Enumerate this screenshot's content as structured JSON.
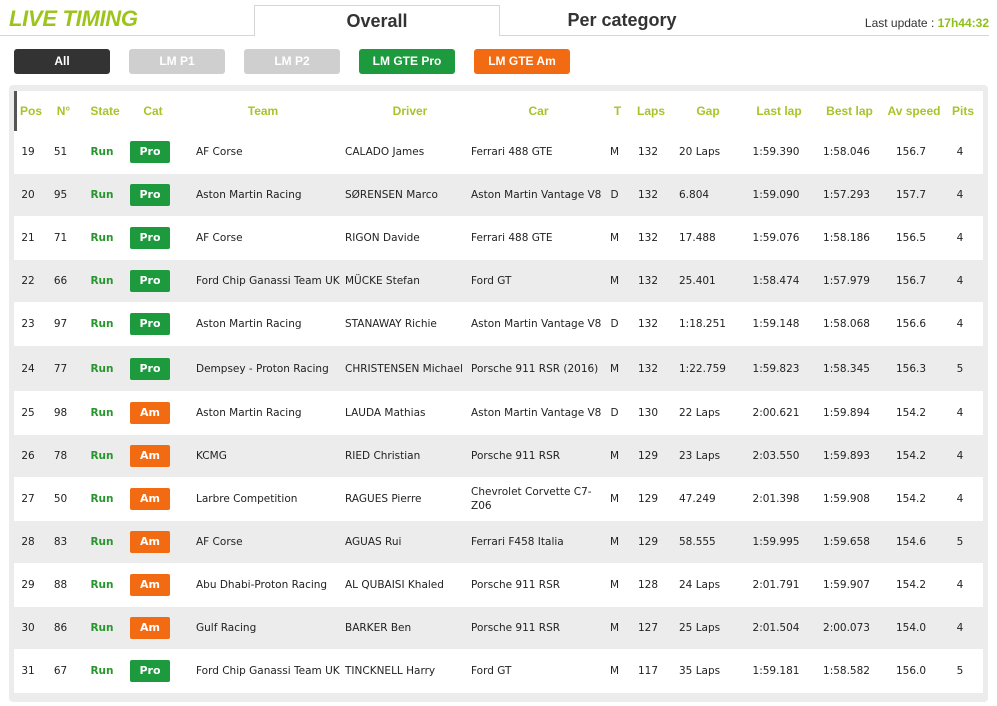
{
  "header": {
    "logo": "LIVE TIMING",
    "tabs": [
      {
        "label": "Overall"
      },
      {
        "label": "Per category"
      }
    ],
    "last_update_label": "Last update :",
    "last_update_time": "17h44:32"
  },
  "filters": [
    {
      "label": "All",
      "color": "#333333"
    },
    {
      "label": "LM P1",
      "color": "#cfcfcf"
    },
    {
      "label": "LM P2",
      "color": "#cfcfcf"
    },
    {
      "label": "LM GTE Pro",
      "color": "#1d9a3d"
    },
    {
      "label": "LM GTE Am",
      "color": "#f26b12"
    }
  ],
  "columns": {
    "pos": "Pos",
    "num": "N°",
    "state": "State",
    "cat": "Cat",
    "team": "Team",
    "driver": "Driver",
    "car": "Car",
    "t": "T",
    "laps": "Laps",
    "gap": "Gap",
    "last_lap": "Last lap",
    "best_lap": "Best lap",
    "av_speed": "Av speed",
    "pits": "Pits"
  },
  "colors": {
    "header_text": "#a6c528",
    "run": "#27962d",
    "pro": "#1d9a3d",
    "am": "#f26b12"
  },
  "rows": [
    {
      "pos": "19",
      "num": "51",
      "state": "Run",
      "cat": "Pro",
      "team": "AF Corse",
      "driver": "CALADO James",
      "car": "Ferrari 488 GTE",
      "t": "M",
      "laps": "132",
      "gap": "20 Laps",
      "last_lap": "1:59.390",
      "best_lap": "1:58.046",
      "av_speed": "156.7",
      "pits": "4"
    },
    {
      "pos": "20",
      "num": "95",
      "state": "Run",
      "cat": "Pro",
      "team": "Aston Martin Racing",
      "driver": "SØRENSEN Marco",
      "car": "Aston Martin Vantage V8",
      "t": "D",
      "laps": "132",
      "gap": "6.804",
      "last_lap": "1:59.090",
      "best_lap": "1:57.293",
      "av_speed": "157.7",
      "pits": "4"
    },
    {
      "pos": "21",
      "num": "71",
      "state": "Run",
      "cat": "Pro",
      "team": "AF Corse",
      "driver": "RIGON Davide",
      "car": "Ferrari 488 GTE",
      "t": "M",
      "laps": "132",
      "gap": "17.488",
      "last_lap": "1:59.076",
      "best_lap": "1:58.186",
      "av_speed": "156.5",
      "pits": "4"
    },
    {
      "pos": "22",
      "num": "66",
      "state": "Run",
      "cat": "Pro",
      "team": "Ford Chip Ganassi Team UK",
      "driver": "MÜCKE Stefan",
      "car": "Ford GT",
      "t": "M",
      "laps": "132",
      "gap": "25.401",
      "last_lap": "1:58.474",
      "best_lap": "1:57.979",
      "av_speed": "156.7",
      "pits": "4"
    },
    {
      "pos": "23",
      "num": "97",
      "state": "Run",
      "cat": "Pro",
      "team": "Aston Martin Racing",
      "driver": "STANAWAY Richie",
      "car": "Aston Martin Vantage V8",
      "t": "D",
      "laps": "132",
      "gap": "1:18.251",
      "last_lap": "1:59.148",
      "best_lap": "1:58.068",
      "av_speed": "156.6",
      "pits": "4"
    },
    {
      "pos": "24",
      "num": "77",
      "state": "Run",
      "cat": "Pro",
      "team": "Dempsey - Proton Racing",
      "driver": "CHRISTENSEN Michael",
      "car": "Porsche 911 RSR (2016)",
      "t": "M",
      "laps": "132",
      "gap": "1:22.759",
      "last_lap": "1:59.823",
      "best_lap": "1:58.345",
      "av_speed": "156.3",
      "pits": "5"
    },
    {
      "pos": "25",
      "num": "98",
      "state": "Run",
      "cat": "Am",
      "team": "Aston Martin Racing",
      "driver": "LAUDA Mathias",
      "car": "Aston Martin Vantage V8",
      "t": "D",
      "laps": "130",
      "gap": "22 Laps",
      "last_lap": "2:00.621",
      "best_lap": "1:59.894",
      "av_speed": "154.2",
      "pits": "4"
    },
    {
      "pos": "26",
      "num": "78",
      "state": "Run",
      "cat": "Am",
      "team": "KCMG",
      "driver": "RIED Christian",
      "car": "Porsche 911 RSR",
      "t": "M",
      "laps": "129",
      "gap": "23 Laps",
      "last_lap": "2:03.550",
      "best_lap": "1:59.893",
      "av_speed": "154.2",
      "pits": "4"
    },
    {
      "pos": "27",
      "num": "50",
      "state": "Run",
      "cat": "Am",
      "team": "Larbre Competition",
      "driver": "RAGUES Pierre",
      "car": "Chevrolet Corvette C7-Z06",
      "t": "M",
      "laps": "129",
      "gap": "47.249",
      "last_lap": "2:01.398",
      "best_lap": "1:59.908",
      "av_speed": "154.2",
      "pits": "4"
    },
    {
      "pos": "28",
      "num": "83",
      "state": "Run",
      "cat": "Am",
      "team": "AF Corse",
      "driver": "AGUAS Rui",
      "car": "Ferrari F458 Italia",
      "t": "M",
      "laps": "129",
      "gap": "58.555",
      "last_lap": "1:59.995",
      "best_lap": "1:59.658",
      "av_speed": "154.6",
      "pits": "5"
    },
    {
      "pos": "29",
      "num": "88",
      "state": "Run",
      "cat": "Am",
      "team": "Abu Dhabi-Proton Racing",
      "driver": "AL QUBAISI Khaled",
      "car": "Porsche 911 RSR",
      "t": "M",
      "laps": "128",
      "gap": "24 Laps",
      "last_lap": "2:01.791",
      "best_lap": "1:59.907",
      "av_speed": "154.2",
      "pits": "4"
    },
    {
      "pos": "30",
      "num": "86",
      "state": "Run",
      "cat": "Am",
      "team": "Gulf Racing",
      "driver": "BARKER Ben",
      "car": "Porsche 911 RSR",
      "t": "M",
      "laps": "127",
      "gap": "25 Laps",
      "last_lap": "2:01.504",
      "best_lap": "2:00.073",
      "av_speed": "154.0",
      "pits": "4"
    },
    {
      "pos": "31",
      "num": "67",
      "state": "Run",
      "cat": "Pro",
      "team": "Ford Chip Ganassi Team UK",
      "driver": "TINCKNELL Harry",
      "car": "Ford GT",
      "t": "M",
      "laps": "117",
      "gap": "35 Laps",
      "last_lap": "1:59.181",
      "best_lap": "1:58.582",
      "av_speed": "156.0",
      "pits": "5"
    }
  ]
}
